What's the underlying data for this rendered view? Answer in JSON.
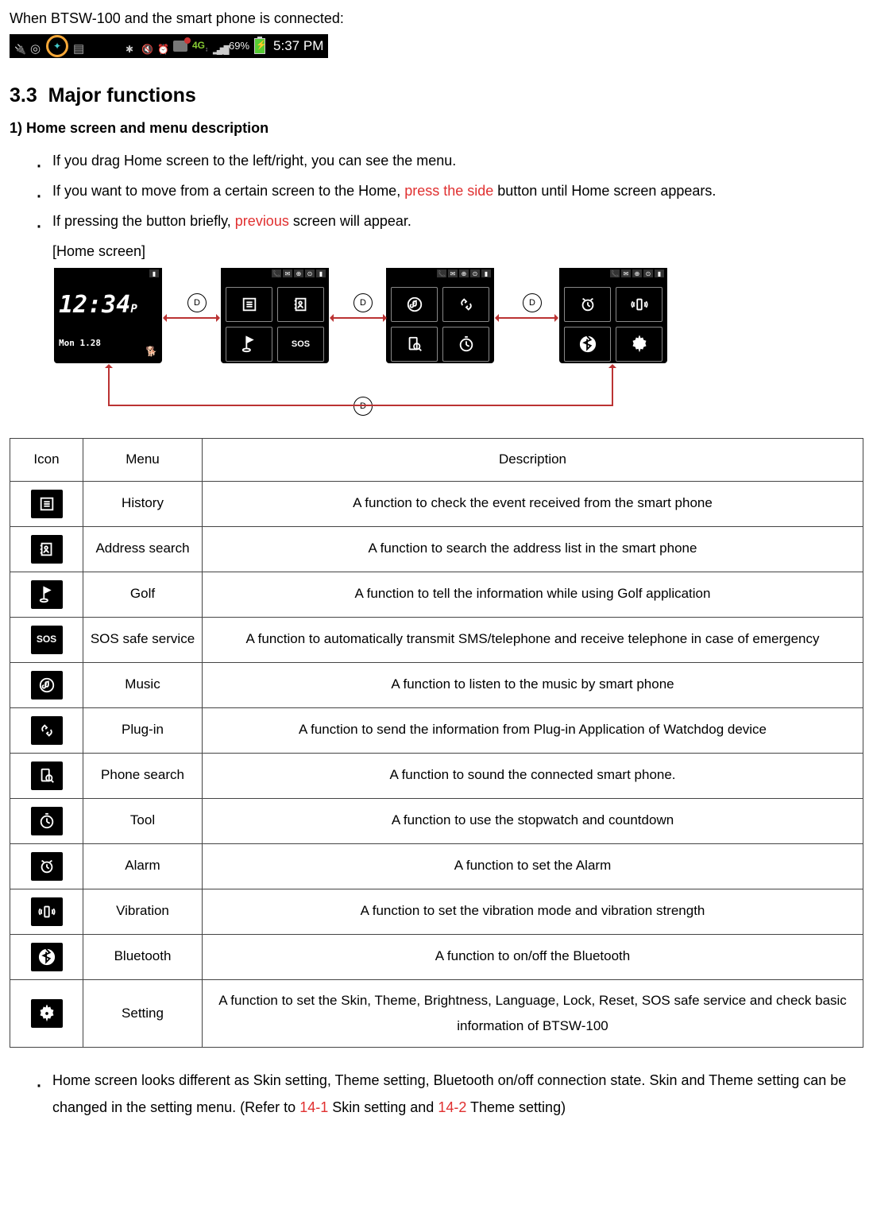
{
  "intro": "When BTSW-100 and the smart phone is connected:",
  "statusbar": {
    "percent": "69%",
    "network": "4G",
    "time": "5:37 PM"
  },
  "section": {
    "number": "3.3",
    "title": "Major functions"
  },
  "sub1": "1) Home screen and menu description",
  "bullets1": {
    "b1": "If you drag Home screen to the left/right, you can see the menu.",
    "b2a": "If you want to move from a certain screen to the Home, ",
    "b2_red": "press the side",
    "b2b": " button until Home screen appears.",
    "b3a": "If pressing the button briefly, ",
    "b3_red": "previous",
    "b3b": " screen will appear.",
    "b4": "[Home screen]"
  },
  "diagram": {
    "clock": "12:34",
    "ampm": "P",
    "date": "Mon 1.28",
    "sos": "SOS",
    "d_label": "D"
  },
  "table": {
    "head": {
      "icon": "Icon",
      "menu": "Menu",
      "desc": "Description"
    },
    "rows": [
      {
        "menu": "History",
        "desc": "A function to check the event received from the smart phone"
      },
      {
        "menu": "Address search",
        "desc": "A function to search the address list in the smart phone"
      },
      {
        "menu": "Golf",
        "desc": "A function to tell the information while using Golf application"
      },
      {
        "menu": "SOS safe service",
        "desc": "A function to automatically transmit SMS/telephone and receive telephone in case of emergency"
      },
      {
        "menu": "Music",
        "desc": "A function to listen to the music by smart phone"
      },
      {
        "menu": "Plug-in",
        "desc": "A function to send the information from Plug-in Application of Watchdog device"
      },
      {
        "menu": "Phone search",
        "desc": "A function to sound the connected smart phone."
      },
      {
        "menu": "Tool",
        "desc": "A function to use the stopwatch and countdown"
      },
      {
        "menu": "Alarm",
        "desc": "A function to set the Alarm"
      },
      {
        "menu": "Vibration",
        "desc": "A function to set the vibration mode and vibration strength"
      },
      {
        "menu": "Bluetooth",
        "desc": "A function to on/off the Bluetooth"
      },
      {
        "menu": "Setting",
        "desc": "A function to set the Skin, Theme, Brightness, Language, Lock, Reset, SOS safe service and check basic information of BTSW-100"
      }
    ]
  },
  "bullets2": {
    "a": "Home screen looks different as Skin setting, Theme setting, Bluetooth on/off connection state.   Skin and Theme setting can be changed in the setting menu. (Refer to ",
    "r1": "14-1",
    "m": " Skin setting and ",
    "r2": "14-2",
    "e": " Theme setting)"
  }
}
